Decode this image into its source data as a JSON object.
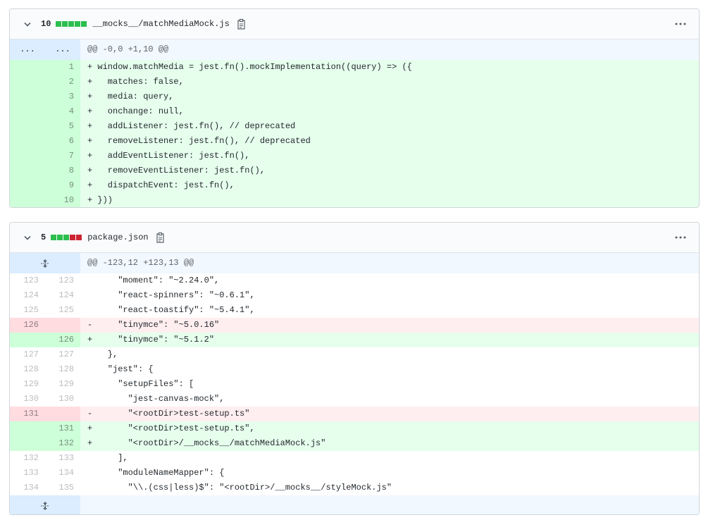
{
  "files": [
    {
      "count": "10",
      "blocks": [
        "add",
        "add",
        "add",
        "add",
        "add"
      ],
      "name": "__mocks__/matchMediaMock.js",
      "hunk": "@@ -0,0 +1,10 @@",
      "hunk_left": "...",
      "hunk_right": "..."
    },
    {
      "count": "5",
      "blocks": [
        "add",
        "add",
        "add",
        "del",
        "del"
      ],
      "name": "package.json",
      "hunk": "@@ -123,12 +123,13 @@"
    }
  ],
  "file1_lines": [
    {
      "new": "1",
      "type": "add",
      "text": "+ window.matchMedia = jest.fn().mockImplementation((query) => ({"
    },
    {
      "new": "2",
      "type": "add",
      "text": "+   matches: false,"
    },
    {
      "new": "3",
      "type": "add",
      "text": "+   media: query,"
    },
    {
      "new": "4",
      "type": "add",
      "text": "+   onchange: null,"
    },
    {
      "new": "5",
      "type": "add",
      "text": "+   addListener: jest.fn(), // deprecated"
    },
    {
      "new": "6",
      "type": "add",
      "text": "+   removeListener: jest.fn(), // deprecated"
    },
    {
      "new": "7",
      "type": "add",
      "text": "+   addEventListener: jest.fn(),"
    },
    {
      "new": "8",
      "type": "add",
      "text": "+   removeEventListener: jest.fn(),"
    },
    {
      "new": "9",
      "type": "add",
      "text": "+   dispatchEvent: jest.fn(),"
    },
    {
      "new": "10",
      "type": "add",
      "text": "+ }))"
    }
  ],
  "file2_lines": [
    {
      "old": "123",
      "new": "123",
      "type": "ctx",
      "text": "      \"moment\": \"~2.24.0\","
    },
    {
      "old": "124",
      "new": "124",
      "type": "ctx",
      "text": "      \"react-spinners\": \"~0.6.1\","
    },
    {
      "old": "125",
      "new": "125",
      "type": "ctx",
      "text": "      \"react-toastify\": \"~5.4.1\","
    },
    {
      "old": "126",
      "new": "",
      "type": "del",
      "text": "-     \"tinymce\": \"~5.0.16\""
    },
    {
      "old": "",
      "new": "126",
      "type": "add",
      "text": "+     \"tinymce\": \"~5.1.2\""
    },
    {
      "old": "127",
      "new": "127",
      "type": "ctx",
      "text": "    },"
    },
    {
      "old": "128",
      "new": "128",
      "type": "ctx",
      "text": "    \"jest\": {"
    },
    {
      "old": "129",
      "new": "129",
      "type": "ctx",
      "text": "      \"setupFiles\": ["
    },
    {
      "old": "130",
      "new": "130",
      "type": "ctx",
      "text": "        \"jest-canvas-mock\","
    },
    {
      "old": "131",
      "new": "",
      "type": "del",
      "text": "-       \"<rootDir>test-setup.ts\""
    },
    {
      "old": "",
      "new": "131",
      "type": "add",
      "text": "+       \"<rootDir>test-setup.ts\","
    },
    {
      "old": "",
      "new": "132",
      "type": "add",
      "text": "+       \"<rootDir>/__mocks__/matchMediaMock.js\""
    },
    {
      "old": "132",
      "new": "133",
      "type": "ctx",
      "text": "      ],"
    },
    {
      "old": "133",
      "new": "134",
      "type": "ctx",
      "text": "      \"moduleNameMapper\": {"
    },
    {
      "old": "134",
      "new": "135",
      "type": "ctx",
      "text": "        \"\\\\.(css|less)$\": \"<rootDir>/__mocks__/styleMock.js\""
    }
  ],
  "colors": {
    "add_block": "#2cbe4e",
    "del_block": "#cb2431",
    "add_bg": "#e6ffed",
    "del_bg": "#ffeef0",
    "hunk_bg": "#f1f8ff"
  },
  "icons": [
    "chevron-down-icon",
    "clipboard-icon",
    "kebab-horizontal-icon",
    "unfold-icon"
  ]
}
